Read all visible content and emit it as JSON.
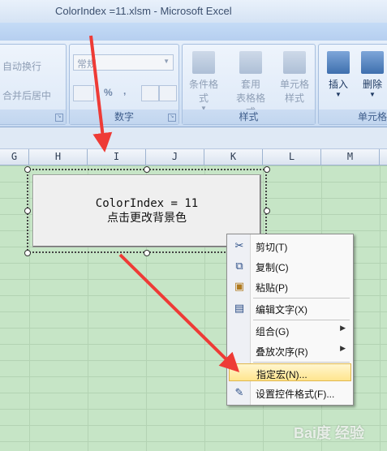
{
  "window": {
    "title": "ColorIndex =11.xlsm - Microsoft Excel"
  },
  "ribbon": {
    "alignment": {
      "wrap_text": "自动换行",
      "merge_center": "合并后居中"
    },
    "number": {
      "format_value": "常规",
      "percent": "%",
      "comma": ",",
      "inc_decimal": ".0→.00",
      "dec_decimal": ".00→.0",
      "label": "数字"
    },
    "styles": {
      "conditional_format": "条件格式",
      "format_table_1": "套用",
      "format_table_2": "表格格式",
      "cell_styles_1": "单元格",
      "cell_styles_2": "样式",
      "label": "样式"
    },
    "cells": {
      "insert": "插入",
      "delete": "删除",
      "label": "单元格"
    }
  },
  "columns": [
    "G",
    "H",
    "I",
    "J",
    "K",
    "L",
    "M"
  ],
  "control": {
    "line1": "ColorIndex = 11",
    "line2": "点击更改背景色"
  },
  "context_menu": {
    "items": [
      {
        "label": "剪切(T)",
        "icon": "scissors-icon"
      },
      {
        "label": "复制(C)",
        "icon": "copy-icon"
      },
      {
        "label": "粘贴(P)",
        "icon": "paste-icon"
      },
      {
        "label": "编辑文字(X)",
        "icon": "edit-text-icon"
      },
      {
        "label": "组合(G)",
        "icon": ""
      },
      {
        "label": "叠放次序(R)",
        "icon": ""
      },
      {
        "label": "指定宏(N)...",
        "icon": ""
      },
      {
        "label": "设置控件格式(F)...",
        "icon": "format-control-icon"
      }
    ]
  },
  "watermark": "Bai度 经验",
  "colors": {
    "annotation_arrow": "#ee3b36",
    "highlight": "#ffe58e",
    "sheet_bg": "#c6e5c6"
  }
}
